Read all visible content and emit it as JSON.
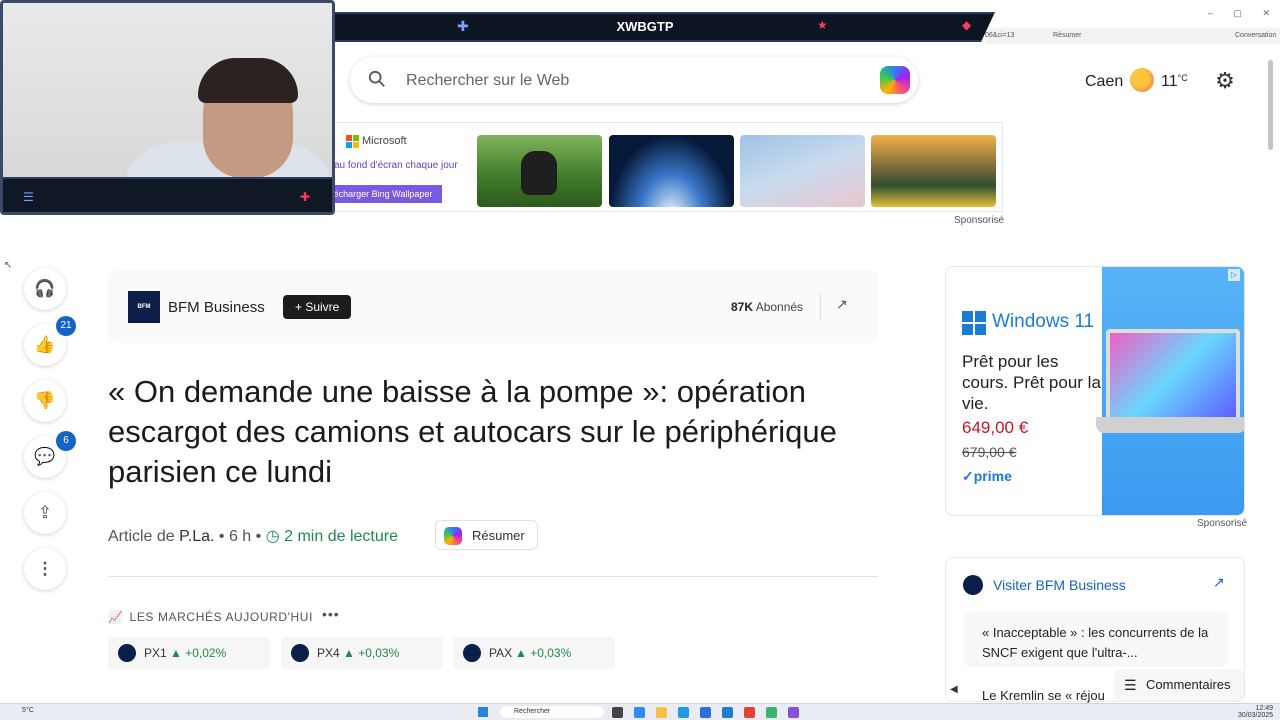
{
  "stream": {
    "title": "XWBGTP"
  },
  "browser": {
    "url_fragment": "06&ci=13",
    "resumer_label": "Résumer",
    "conversation_label": "Conversation",
    "win_min": "–",
    "win_max": "▢",
    "win_close": "✕"
  },
  "search": {
    "placeholder": "Rechercher sur le Web"
  },
  "weather": {
    "city": "Caen",
    "temp": "11",
    "unit": "°C"
  },
  "top_ad": {
    "brand": "Microsoft",
    "tagline": "au fond d'écran chaque jour",
    "cta": "écharger Bing Wallpaper",
    "sponsored": "Sponsorisé"
  },
  "rail": {
    "like_count": "21",
    "comment_count": "6"
  },
  "publisher": {
    "logo_text": "BFM",
    "name": "BFM Business",
    "follow_label": "+ Suivre",
    "subscribers_count": "87K",
    "subscribers_label": "Abonnés"
  },
  "article": {
    "headline": "« On demande une baisse à la pompe »: opération escargot des camions et autocars sur le périphérique parisien ce lundi",
    "byline_prefix": "Article de",
    "author": "P.La.",
    "age": "• 6 h •",
    "read_time": "2 min de lecture",
    "summarize_label": "Résumer"
  },
  "markets": {
    "title": "LES MARCHÉS AUJOURD'HUI",
    "tickers": [
      {
        "symbol": "PX1",
        "change": "▲ +0,02%"
      },
      {
        "symbol": "PX4",
        "change": "▲ +0,03%"
      },
      {
        "symbol": "PAX",
        "change": "▲ +0,03%"
      }
    ]
  },
  "right_ad": {
    "product": "Windows 11",
    "pitch": "Prêt pour les cours. Prêt pour la vie.",
    "price": "649,00 €",
    "old_price": "679,00 €",
    "prime": "✓prime",
    "sponsored": "Sponsorisé"
  },
  "visit_card": {
    "title": "Visiter BFM Business",
    "item1": "« Inacceptable » : les concurrents de la SNCF exigent que l'ultra-...",
    "item2": "Le Kremlin se « réjou"
  },
  "comments_label": "Commentaires",
  "taskbar": {
    "search_placeholder": "Rechercher",
    "weather": "5°C",
    "time": "12:49",
    "date": "30/03/2025"
  },
  "colors": {
    "accent": "#1463c7",
    "positive": "#1f8a4c",
    "price_red": "#c4162a",
    "windows_blue": "#1a7cd6"
  }
}
